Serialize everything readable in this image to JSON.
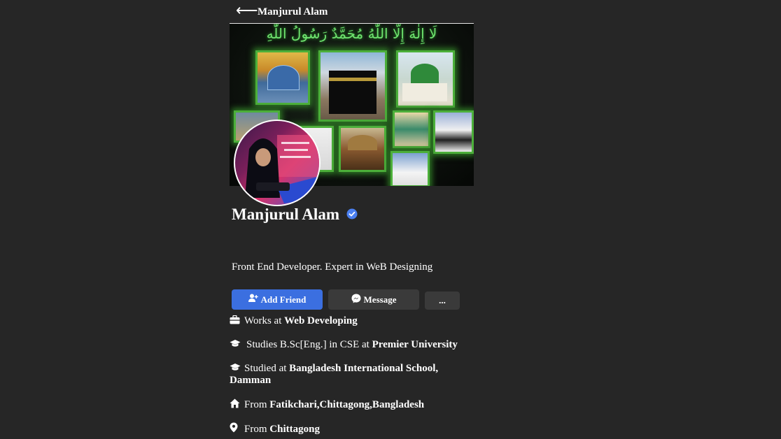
{
  "header": {
    "back_icon": "left-arrow-icon",
    "title": "Manjurul Alam"
  },
  "cover": {
    "calligraphy": "لَا إِلٰهَ إِلَّا اللّٰهُ مُحَمَّدٌ رَسُولُ اللّٰهِ"
  },
  "profile": {
    "name": "Manjurul Alam",
    "verified_icon": "verified-badge-icon",
    "bio": "Front End Developer. Expert in WeB Designing"
  },
  "actions": {
    "add_friend": "Add Friend",
    "message": "Message",
    "more": "..."
  },
  "details": [
    {
      "icon": "briefcase-icon",
      "prefix": "Works at",
      "value": "Web Developing"
    },
    {
      "icon": "graduation-cap-icon",
      "prefix": "Studies B.Sc[Eng.] in CSE at",
      "value": "Premier University"
    },
    {
      "icon": "graduation-cap-icon",
      "prefix": "Studied at",
      "value": "Bangladesh International School, Damman"
    },
    {
      "icon": "home-icon",
      "prefix": "From",
      "value": "Fatikchari,Chittagong,Bangladesh"
    },
    {
      "icon": "location-pin-icon",
      "prefix": "From",
      "value": "Chittagong"
    }
  ],
  "colors": {
    "background": "#262626",
    "accent": "#3b6fe0",
    "secondary_button": "#3a3a3a",
    "verified": "#4a7ff0"
  }
}
